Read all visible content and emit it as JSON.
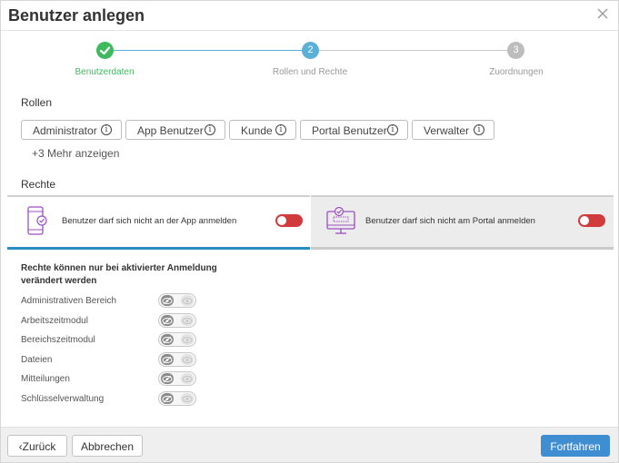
{
  "dialog": {
    "title": "Benutzer anlegen"
  },
  "stepper": {
    "steps": [
      {
        "label": "Benutzerdaten",
        "number": "",
        "state": "done"
      },
      {
        "label": "Rollen und Rechte",
        "number": "2",
        "state": "active"
      },
      {
        "label": "Zuordnungen",
        "number": "3",
        "state": "pending"
      }
    ]
  },
  "roles": {
    "heading": "Rollen",
    "chips": [
      {
        "label": "Administrator"
      },
      {
        "label": "App Benutzer"
      },
      {
        "label": "Kunde"
      },
      {
        "label": "Portal Benutzer"
      },
      {
        "label": "Verwalter"
      }
    ],
    "info_glyph": "i",
    "more_label": "+3 Mehr anzeigen"
  },
  "rights": {
    "heading": "Rechte",
    "tabs": [
      {
        "label": "Benutzer darf sich nicht an der App anmelden",
        "enabled": true
      },
      {
        "label": "Benutzer darf sich nicht am Portal anmelden",
        "enabled": true
      }
    ],
    "hint_line1": "Rechte können nur bei aktivierter Anmeldung",
    "hint_line2": "verändert werden",
    "permissions": [
      {
        "label": "Administrativen Bereich"
      },
      {
        "label": "Arbeitszeitmodul"
      },
      {
        "label": "Bereichszeitmodul"
      },
      {
        "label": "Dateien"
      },
      {
        "label": "Mitteilungen"
      },
      {
        "label": "Schlüsselverwaltung"
      }
    ]
  },
  "footer": {
    "back_label": "Zurück",
    "back_glyph": "‹",
    "cancel_label": "Abbrechen",
    "continue_label": "Fortfahren"
  },
  "colors": {
    "step_done": "#3fba5f",
    "step_active": "#5bb0d8",
    "step_pending": "#bdbdbd",
    "toggle_on": "#d23b3b",
    "primary": "#3f8ed2",
    "icon_purple": "#9b4fc4"
  }
}
